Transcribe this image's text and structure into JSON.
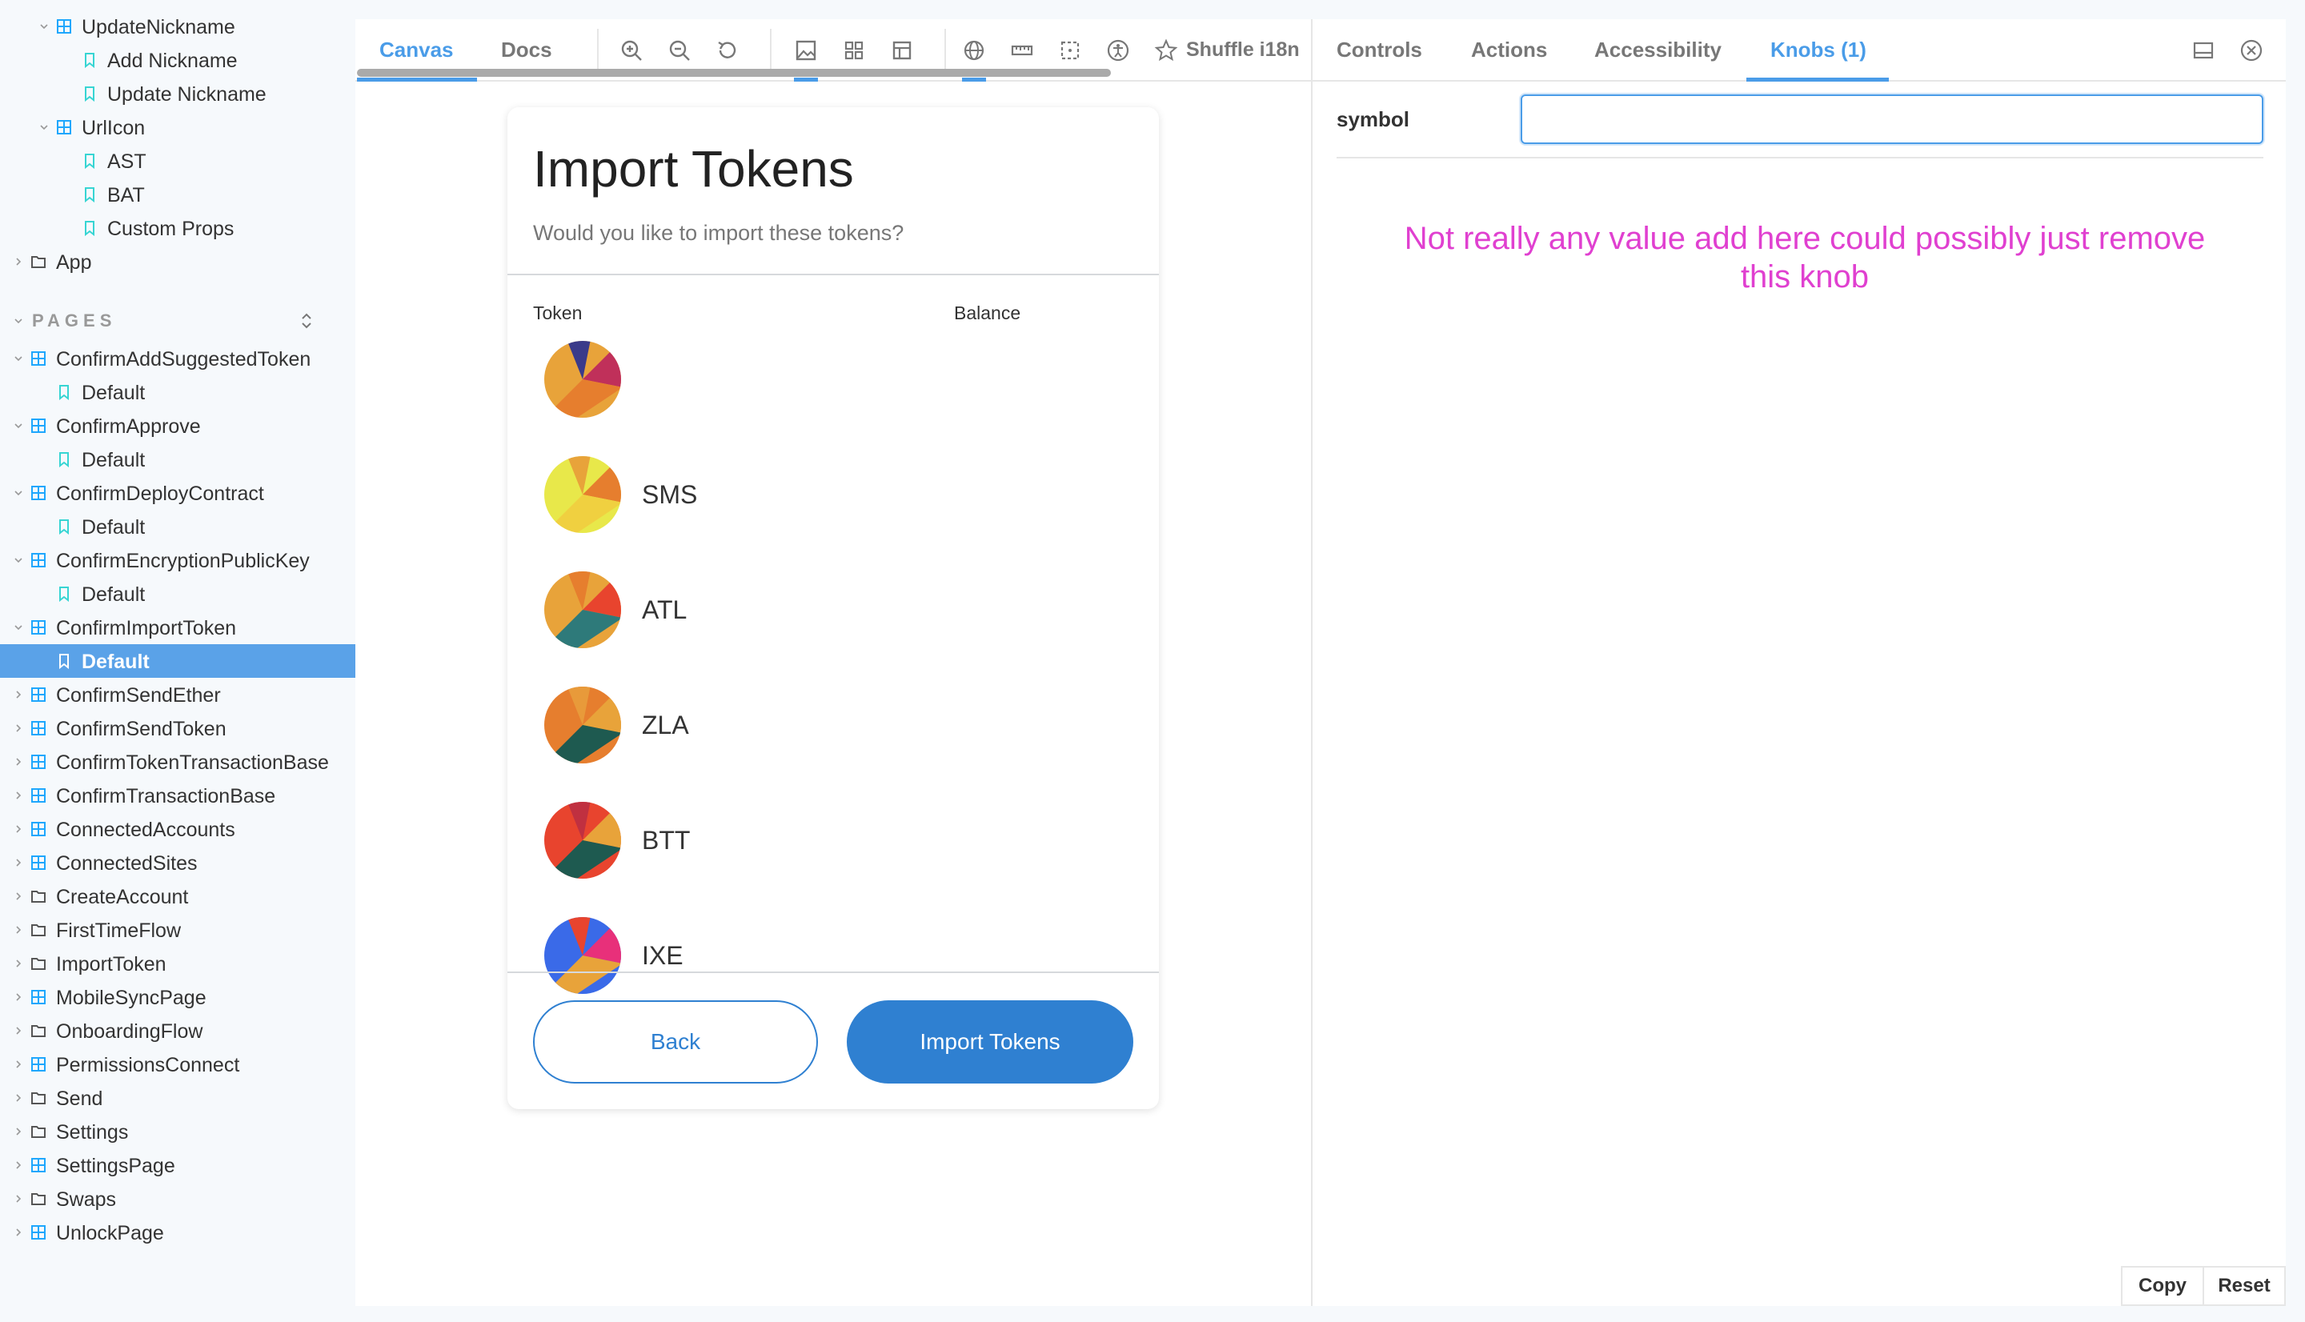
{
  "sidebar": {
    "top_items": [
      {
        "label": "UpdateNickname",
        "type": "component",
        "expanded": true
      },
      {
        "label": "Add Nickname",
        "type": "story"
      },
      {
        "label": "Update Nickname",
        "type": "story"
      },
      {
        "label": "UrlIcon",
        "type": "component",
        "expanded": true
      },
      {
        "label": "AST",
        "type": "story"
      },
      {
        "label": "BAT",
        "type": "story"
      },
      {
        "label": "Custom Props",
        "type": "story"
      },
      {
        "label": "App",
        "type": "folder"
      }
    ],
    "pages_header": "PAGES",
    "pages_items": [
      {
        "label": "ConfirmAddSuggestedToken",
        "type": "component",
        "expanded": true
      },
      {
        "label": "Default",
        "type": "story"
      },
      {
        "label": "ConfirmApprove",
        "type": "component",
        "expanded": true
      },
      {
        "label": "Default",
        "type": "story"
      },
      {
        "label": "ConfirmDeployContract",
        "type": "component",
        "expanded": true
      },
      {
        "label": "Default",
        "type": "story"
      },
      {
        "label": "ConfirmEncryptionPublicKey",
        "type": "component",
        "expanded": true
      },
      {
        "label": "Default",
        "type": "story"
      },
      {
        "label": "ConfirmImportToken",
        "type": "component",
        "expanded": true
      },
      {
        "label": "Default",
        "type": "story",
        "selected": true
      },
      {
        "label": "ConfirmSendEther",
        "type": "component"
      },
      {
        "label": "ConfirmSendToken",
        "type": "component"
      },
      {
        "label": "ConfirmTokenTransactionBase",
        "type": "component"
      },
      {
        "label": "ConfirmTransactionBase",
        "type": "component"
      },
      {
        "label": "ConnectedAccounts",
        "type": "component"
      },
      {
        "label": "ConnectedSites",
        "type": "component"
      },
      {
        "label": "CreateAccount",
        "type": "folder"
      },
      {
        "label": "FirstTimeFlow",
        "type": "folder"
      },
      {
        "label": "ImportToken",
        "type": "folder"
      },
      {
        "label": "MobileSyncPage",
        "type": "component"
      },
      {
        "label": "OnboardingFlow",
        "type": "folder"
      },
      {
        "label": "PermissionsConnect",
        "type": "component"
      },
      {
        "label": "Send",
        "type": "folder"
      },
      {
        "label": "Settings",
        "type": "folder"
      },
      {
        "label": "SettingsPage",
        "type": "component"
      },
      {
        "label": "Swaps",
        "type": "folder"
      },
      {
        "label": "UnlockPage",
        "type": "component"
      }
    ]
  },
  "canvas_toolbar": {
    "tab_canvas": "Canvas",
    "tab_docs": "Docs",
    "shuffle_label": "Shuffle i18n"
  },
  "addons": {
    "tab_controls": "Controls",
    "tab_actions": "Actions",
    "tab_accessibility": "Accessibility",
    "tab_knobs": "Knobs (1)",
    "knob_label": "symbol",
    "knob_value": "",
    "annotation": "Not really any value add here could possibly just remove this knob",
    "copy_label": "Copy",
    "reset_label": "Reset"
  },
  "preview": {
    "title": "Import Tokens",
    "subtitle": "Would you like to import these tokens?",
    "col_token": "Token",
    "col_balance": "Balance",
    "tokens": [
      {
        "symbol": "",
        "colors": [
          "#e8a33a",
          "#c0305a",
          "#e67e2e",
          "#3a3a8a"
        ]
      },
      {
        "symbol": "SMS",
        "colors": [
          "#e8e84a",
          "#e67e2e",
          "#f0d040",
          "#e8a33a"
        ]
      },
      {
        "symbol": "ATL",
        "colors": [
          "#e8a33a",
          "#e8442e",
          "#2e7a7a",
          "#e67e2e"
        ]
      },
      {
        "symbol": "ZLA",
        "colors": [
          "#e67e2e",
          "#e8a33a",
          "#1e5a50",
          "#e89a3a"
        ]
      },
      {
        "symbol": "BTT",
        "colors": [
          "#e8442e",
          "#e8a33a",
          "#1e5a50",
          "#c03040"
        ]
      },
      {
        "symbol": "IXE",
        "colors": [
          "#3a6ae8",
          "#e8307a",
          "#e8a33a",
          "#e8442e"
        ]
      }
    ],
    "back_label": "Back",
    "import_label": "Import Tokens"
  },
  "colors": {
    "accent": "#4a9ce8",
    "button_blue": "#2f80d1",
    "selected_row": "#5aa2e8",
    "annotation": "#e040d0"
  }
}
